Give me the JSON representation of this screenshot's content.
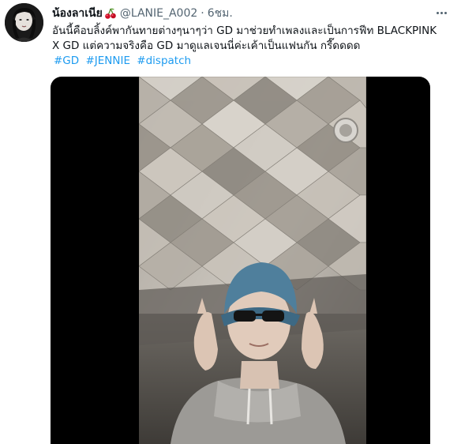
{
  "tweet": {
    "display_name": "น้องลาเนีย",
    "handle": "@LANIE_A002",
    "separator": "·",
    "time": "6ชม.",
    "text_line1": "อันนี้คือบลิ้งค์พากันทายต่างๆนาๆว่า GD มาช่วยทำเพลงและเป็นการฟีท BLACKPINK",
    "text_line2": "X GD แต่ความจริงคือ GD มาดูแลเจนนี่ค่ะเค้าเป็นแฟนกัน กรี๊ดดดด",
    "hashtags": [
      "#GD",
      "#JENNIE",
      "#dispatch"
    ]
  },
  "icons": {
    "cherry": "cherry-emoji-icon",
    "more": "more-options-icon",
    "avatar": "user-avatar"
  },
  "colors": {
    "link": "#1d9bf0",
    "text": "#0f1419",
    "secondary": "#536471",
    "media_background": "#000000"
  }
}
